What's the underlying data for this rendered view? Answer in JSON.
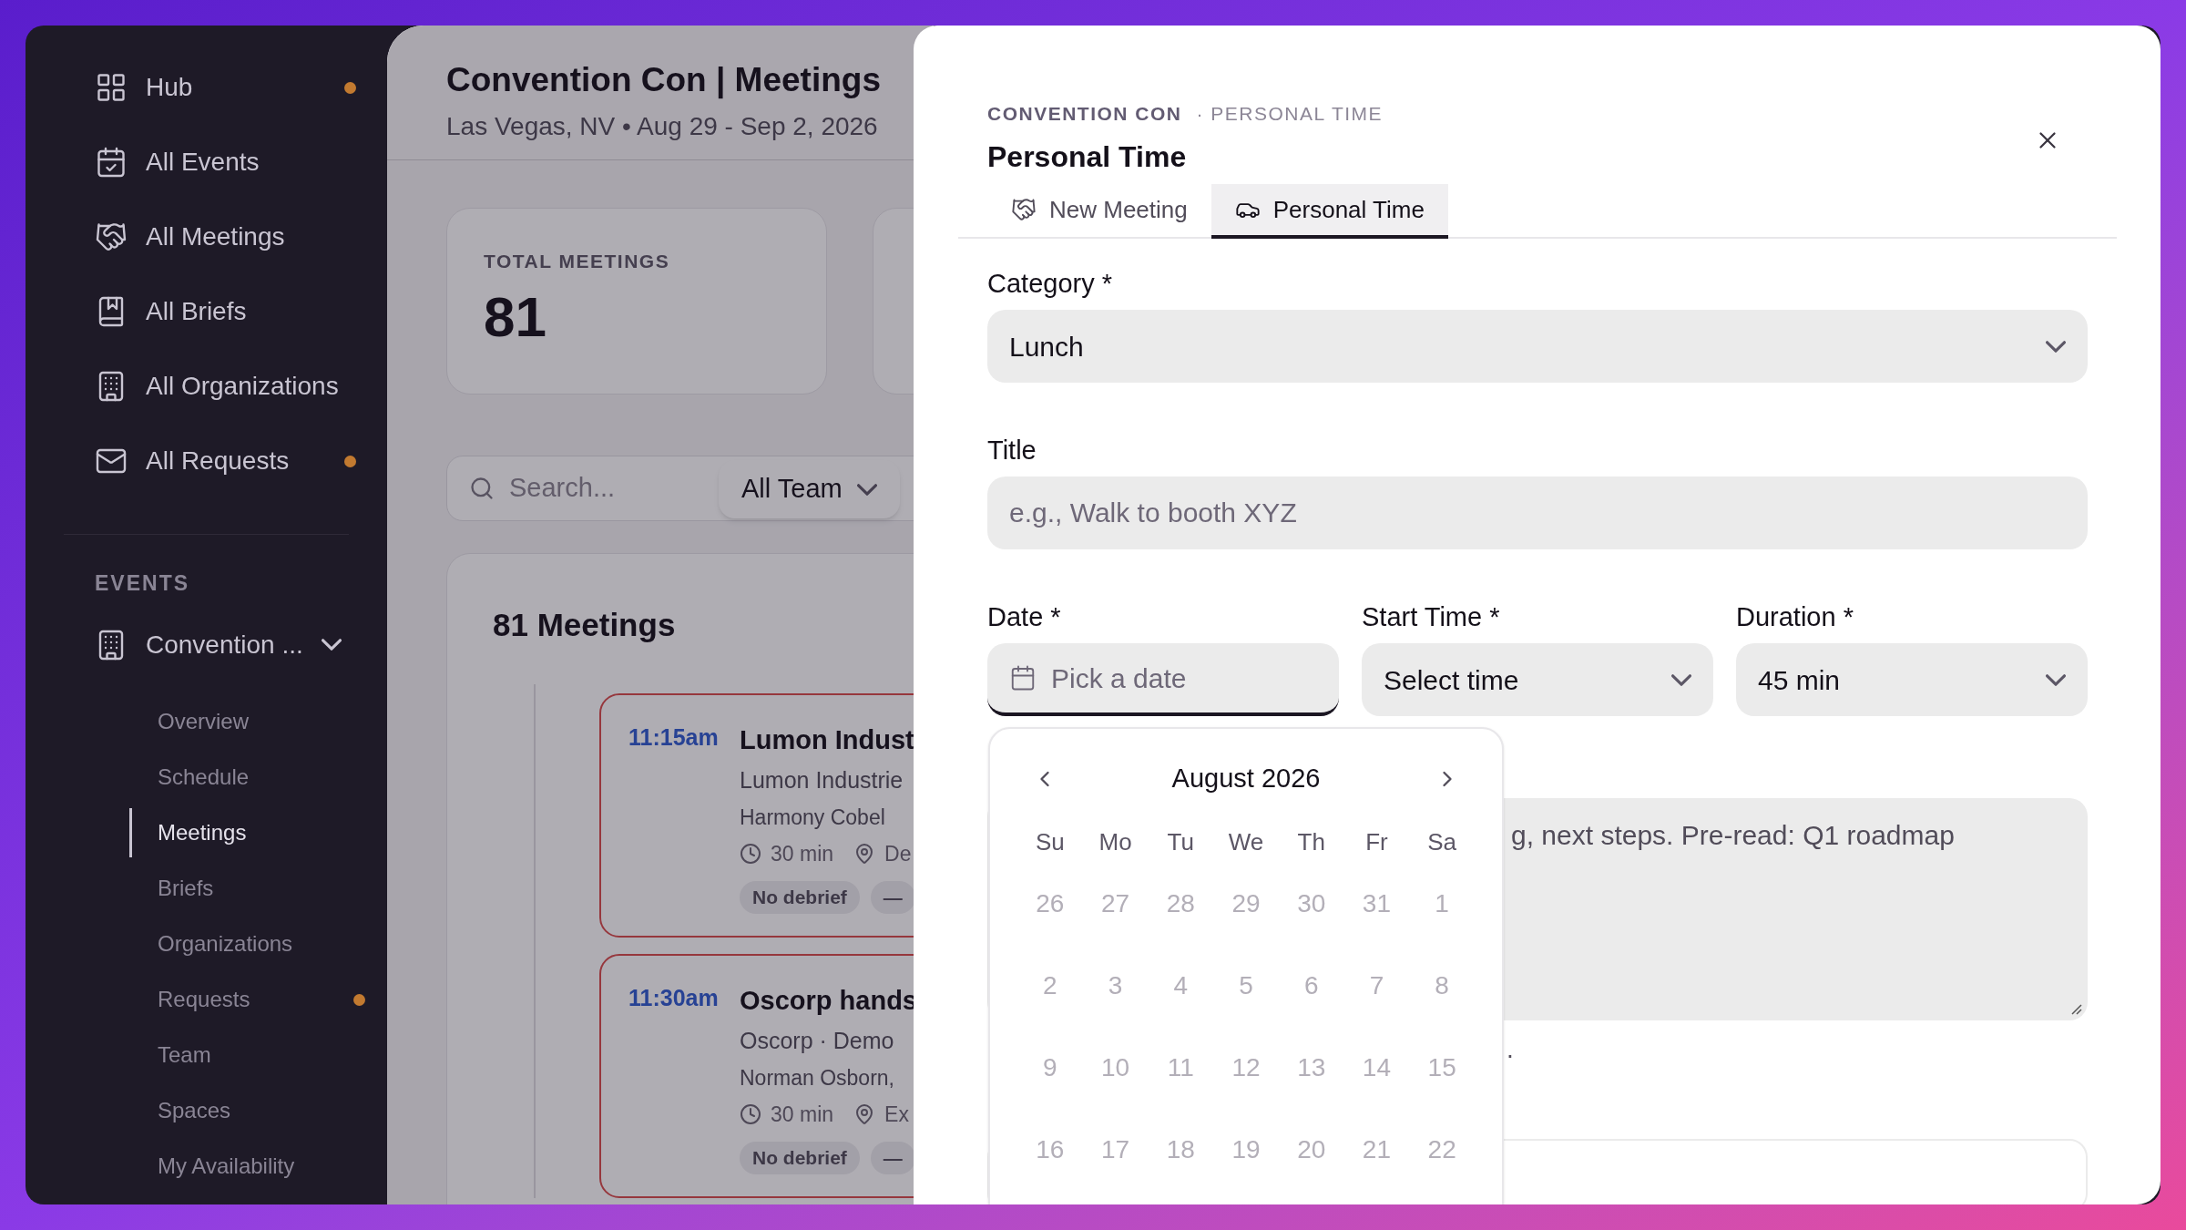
{
  "sidebar": {
    "items": [
      {
        "label": "Hub",
        "dot": true
      },
      {
        "label": "All Events",
        "dot": false
      },
      {
        "label": "All Meetings",
        "dot": false
      },
      {
        "label": "All Briefs",
        "dot": false
      },
      {
        "label": "All Organizations",
        "dot": false
      },
      {
        "label": "All Requests",
        "dot": true
      }
    ],
    "section_label": "EVENTS",
    "event": {
      "label": "Convention ...",
      "expanded": true,
      "children": [
        {
          "label": "Overview",
          "selected": false,
          "dot": false
        },
        {
          "label": "Schedule",
          "selected": false,
          "dot": false
        },
        {
          "label": "Meetings",
          "selected": true,
          "dot": false
        },
        {
          "label": "Briefs",
          "selected": false,
          "dot": false
        },
        {
          "label": "Organizations",
          "selected": false,
          "dot": false
        },
        {
          "label": "Requests",
          "selected": false,
          "dot": true
        },
        {
          "label": "Team",
          "selected": false,
          "dot": false
        },
        {
          "label": "Spaces",
          "selected": false,
          "dot": false
        },
        {
          "label": "My Availability",
          "selected": false,
          "dot": false
        }
      ]
    }
  },
  "header": {
    "title": "Convention Con | Meetings",
    "subtitle": "Las Vegas, NV • Aug 29 - Sep 2, 2026"
  },
  "stats": [
    {
      "label": "TOTAL MEETINGS",
      "value": "81"
    }
  ],
  "search": {
    "placeholder": "Search..."
  },
  "team_filter": {
    "value": "All Team"
  },
  "meetings": {
    "title": "81 Meetings",
    "items": [
      {
        "time": "11:15am",
        "title": "Lumon Indust",
        "subtitle": "Lumon Industrie",
        "people": "Harmony Cobel",
        "duration": "30 min",
        "location": "De",
        "badges": [
          "No debrief",
          "—"
        ]
      },
      {
        "time": "11:30am",
        "title": "Oscorp hands",
        "subtitle": "Oscorp · Demo",
        "people": "Norman Osborn,",
        "duration": "30 min",
        "location": "Ex",
        "badges": [
          "No debrief",
          "—"
        ]
      }
    ]
  },
  "dialog": {
    "breadcrumb": "CONVENTION CON",
    "breadcrumb_sub": "· PERSONAL TIME",
    "title": "Personal Time",
    "tabs": [
      {
        "label": "New Meeting",
        "selected": false
      },
      {
        "label": "Personal Time",
        "selected": true
      }
    ],
    "category": {
      "label": "Category *",
      "value": "Lunch"
    },
    "title_field": {
      "label": "Title",
      "placeholder": "e.g., Walk to booth XYZ"
    },
    "date": {
      "label": "Date *",
      "placeholder": "Pick a date"
    },
    "start_time": {
      "label": "Start Time *",
      "placeholder": "Select time"
    },
    "duration": {
      "label": "Duration *",
      "value": "45 min"
    },
    "notes": {
      "value": "g, next steps. Pre-read: Q1 roadmap"
    },
    "hint": ".",
    "calendar": {
      "month": "August 2026",
      "weekdays": [
        "Su",
        "Mo",
        "Tu",
        "We",
        "Th",
        "Fr",
        "Sa"
      ],
      "weeks": [
        [
          {
            "label": "26",
            "disabled": true
          },
          {
            "label": "27",
            "disabled": true
          },
          {
            "label": "28",
            "disabled": true
          },
          {
            "label": "29",
            "disabled": true
          },
          {
            "label": "30",
            "disabled": true
          },
          {
            "label": "31",
            "disabled": true
          },
          {
            "label": "1",
            "disabled": true
          }
        ],
        [
          {
            "label": "2",
            "disabled": true
          },
          {
            "label": "3",
            "disabled": true
          },
          {
            "label": "4",
            "disabled": true
          },
          {
            "label": "5",
            "disabled": true
          },
          {
            "label": "6",
            "disabled": true
          },
          {
            "label": "7",
            "disabled": true
          },
          {
            "label": "8",
            "disabled": true
          }
        ],
        [
          {
            "label": "9",
            "disabled": true
          },
          {
            "label": "10",
            "disabled": true
          },
          {
            "label": "11",
            "disabled": true
          },
          {
            "label": "12",
            "disabled": true
          },
          {
            "label": "13",
            "disabled": true
          },
          {
            "label": "14",
            "disabled": true
          },
          {
            "label": "15",
            "disabled": true
          }
        ],
        [
          {
            "label": "16",
            "disabled": true
          },
          {
            "label": "17",
            "disabled": true
          },
          {
            "label": "18",
            "disabled": true
          },
          {
            "label": "19",
            "disabled": true
          },
          {
            "label": "20",
            "disabled": true
          },
          {
            "label": "21",
            "disabled": true
          },
          {
            "label": "22",
            "disabled": true
          }
        ]
      ]
    }
  }
}
